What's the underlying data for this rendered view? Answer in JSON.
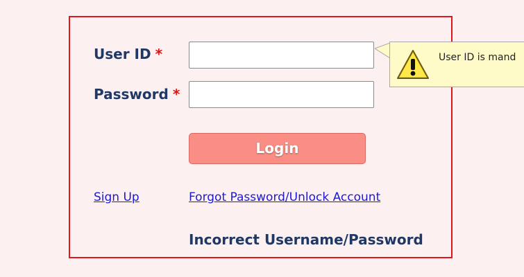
{
  "form": {
    "user_id_label": "User ID",
    "password_label": "Password",
    "required_marker": "*",
    "user_id_value": "",
    "password_value": "",
    "login_label": "Login",
    "signup_link": "Sign Up",
    "forgot_link": "Forgot Password/Unlock Account",
    "error_message": "Incorrect Username/Password"
  },
  "tooltip": {
    "message": "User ID is mand",
    "icon": "warning-icon"
  },
  "colors": {
    "panel_border": "#e0161c",
    "login_button": "#fb8e84",
    "label_text": "#1f3864",
    "link": "#1a1ad6",
    "tooltip_background": "#fffbc9",
    "required_marker": "#e01010"
  }
}
